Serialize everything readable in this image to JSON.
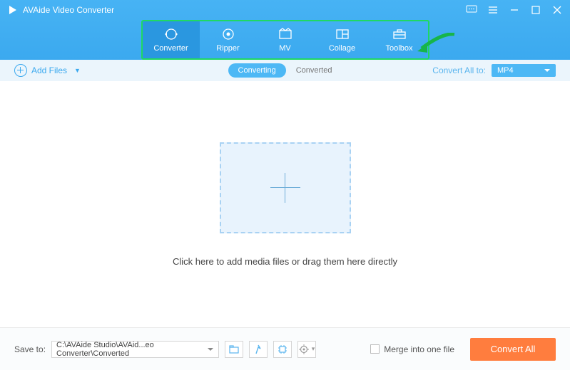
{
  "app": {
    "title": "AVAide Video Converter"
  },
  "tabs": [
    {
      "label": "Converter"
    },
    {
      "label": "Ripper"
    },
    {
      "label": "MV"
    },
    {
      "label": "Collage"
    },
    {
      "label": "Toolbox"
    }
  ],
  "subbar": {
    "add_files": "Add Files",
    "converting": "Converting",
    "converted": "Converted",
    "convert_all_to": "Convert All to:",
    "format": "MP4"
  },
  "main": {
    "hint": "Click here to add media files or drag them here directly"
  },
  "footer": {
    "save_to": "Save to:",
    "path": "C:\\AVAide Studio\\AVAid...eo Converter\\Converted",
    "merge": "Merge into one file",
    "convert_all": "Convert All"
  }
}
